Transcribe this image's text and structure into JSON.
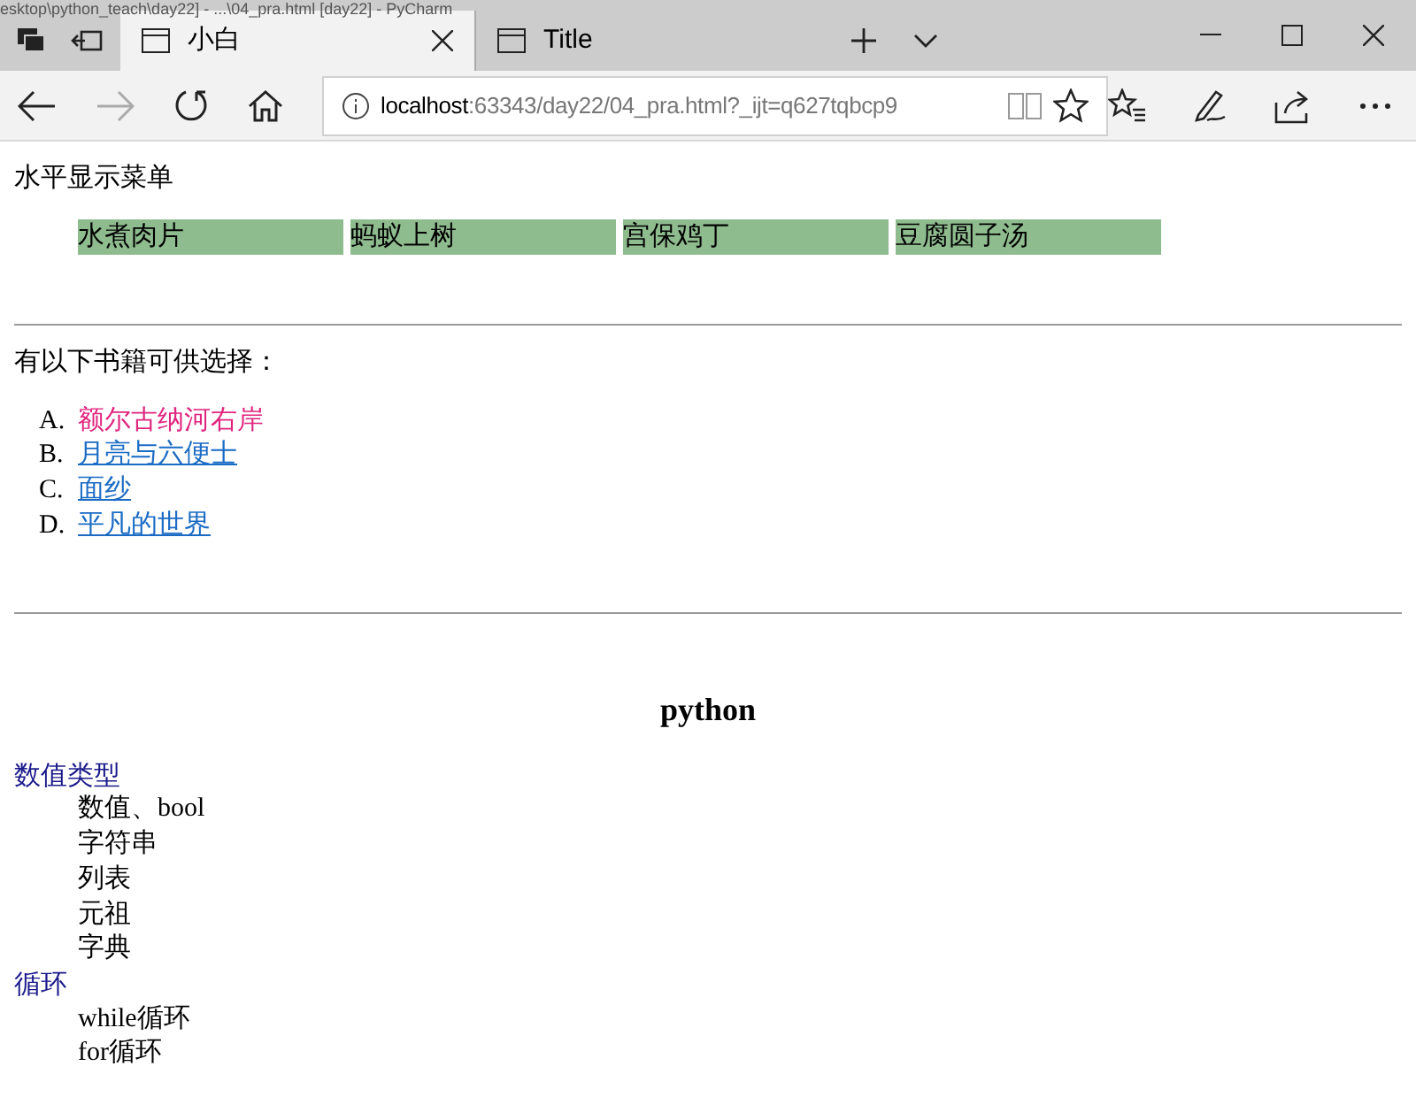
{
  "title_bar": {
    "title": "esktop\\python_teach\\day22] - ...\\04_pra.html [day22] - PyCharm"
  },
  "tabs": [
    {
      "label": "小白",
      "selected": true,
      "closable": true
    },
    {
      "label": "Title",
      "selected": false,
      "closable": false
    }
  ],
  "address_bar": {
    "host": "localhost",
    "rest": ":63343/day22/04_pra.html?_ijt=q627tqbcp9"
  },
  "page": {
    "menu_title": "水平显示菜单",
    "menu_items": [
      "水煮肉片",
      "蚂蚁上树",
      "宫保鸡丁",
      "豆腐圆子汤"
    ],
    "books_title": "有以下书籍可供选择：",
    "books": [
      {
        "marker": "A.",
        "title": "额尔古纳河右岸",
        "color": "#e0257f",
        "underlined": false
      },
      {
        "marker": "B.",
        "title": "月亮与六便士",
        "color": "#1a6bc4",
        "underlined": true
      },
      {
        "marker": "C.",
        "title": "面纱",
        "color": "#1a6bc4",
        "underlined": true
      },
      {
        "marker": "D.",
        "title": "平凡的世界",
        "color": "#1a6bc4",
        "underlined": true
      }
    ],
    "heading": "python",
    "terms": [
      {
        "term": "数值类型",
        "items": [
          "数值、bool",
          "字符串",
          "列表",
          "元祖",
          "字典"
        ]
      },
      {
        "term": "循环",
        "items": [
          "while循环",
          "for循环"
        ]
      }
    ]
  }
}
